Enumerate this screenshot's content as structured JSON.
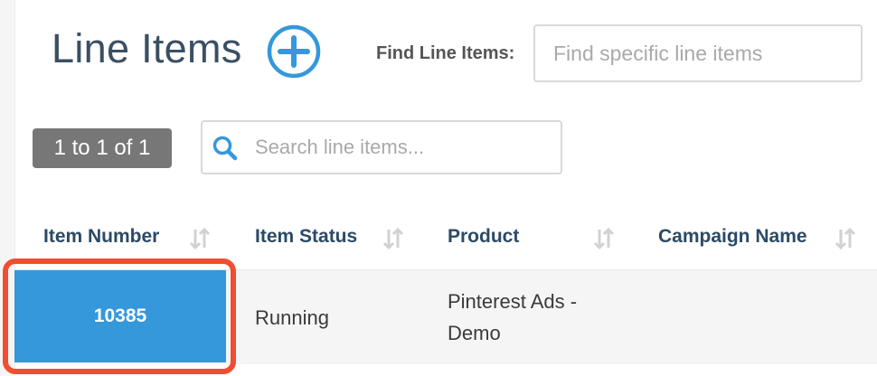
{
  "header": {
    "title": "Line Items",
    "add_icon": "plus-circle-icon",
    "find_label": "Find Line Items:",
    "find_placeholder": "Find specific line items",
    "find_value": ""
  },
  "toolbar": {
    "count_text": "1 to 1 of 1",
    "search_placeholder": "Search line items...",
    "search_value": "",
    "search_icon": "search-icon"
  },
  "table": {
    "columns": [
      {
        "label": "Item Number",
        "sort_icon": "sort-icon"
      },
      {
        "label": "Item Status",
        "sort_icon": "sort-icon"
      },
      {
        "label": "Product",
        "sort_icon": "sort-icon"
      },
      {
        "label": "Campaign Name",
        "sort_icon": "sort-icon"
      }
    ],
    "rows": [
      {
        "item_number": "10385",
        "status": "Running",
        "product_line1": "Pinterest Ads -",
        "product_line2": "Demo",
        "campaign_name": ""
      }
    ]
  },
  "colors": {
    "accent": "#3498db",
    "title_text": "#3a4f63",
    "header_text": "#2c4a66",
    "badge_bg": "#777777",
    "highlight": "#f04e30"
  }
}
